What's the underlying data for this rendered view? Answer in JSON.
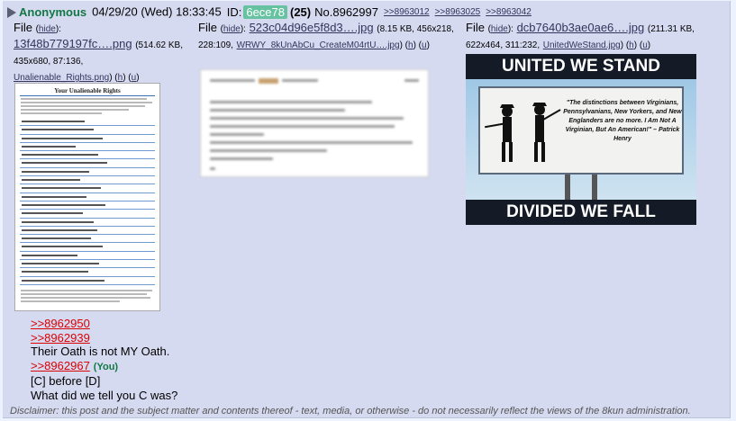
{
  "post": {
    "name": "Anonymous",
    "date": "04/29/20 (Wed) 18:33:45",
    "id_label": "ID:",
    "id_value": "6ece78",
    "post_count": "(25)",
    "post_no": "No.8962997",
    "backlinks": [
      ">>8963012",
      ">>8963025",
      ">>8963042"
    ]
  },
  "files": [
    {
      "label": "File",
      "hide": "hide",
      "filename": "13f48b779197fc….png",
      "size_dims": "(514.62 KB, 435x680, 87:136,",
      "orig_name": "Unalienable_Rights.png",
      "h": "h",
      "u": "u"
    },
    {
      "label": "File",
      "hide": "hide",
      "filename": "523c04d96e5f8d3….jpg",
      "size_dims": "(8.15 KB, 456x218, 228:109,",
      "orig_name": "WRWY_8kUnAbCu_CreateM04rtU….jpg",
      "h": "h",
      "u": "u"
    },
    {
      "label": "File",
      "hide": "hide",
      "filename": "dcb7640b3ae0ae6….jpg",
      "size_dims": "(211.31 KB, 622x464, 311:232,",
      "orig_name": "UnitedWeStand.jpg",
      "h": "h",
      "u": "u"
    }
  ],
  "thumbs": {
    "doc_title": "Your Unalienable Rights",
    "billboard_top": "UNITED WE STAND",
    "billboard_bottom": "DIVIDED WE FALL",
    "billboard_quote": "\"The distinctions between Virginians, Pennsylvanians, New Yorkers, and New Englanders are no more. I Am Not A Virginian, But An American!\" – Patrick Henry"
  },
  "body": {
    "quote1": ">>8962950",
    "quote2": ">>8962939",
    "line1": "Their Oath is not MY Oath.",
    "quote3": ">>8962967",
    "you": "(You)",
    "line2": "[C] before [D]",
    "line3": "What did we tell you C was?"
  },
  "disclaimer": "Disclaimer: this post and the subject matter and contents thereof - text, media, or otherwise - do not necessarily reflect the views of the 8kun administration."
}
